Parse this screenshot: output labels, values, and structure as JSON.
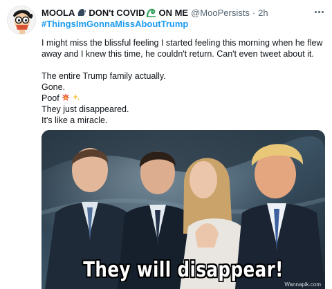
{
  "tweet": {
    "display_name_part1": "MOOLA",
    "display_name_part2": "DON't COVID",
    "display_name_part3": "ON ME",
    "handle": "@MooPersists",
    "separator": "·",
    "time": "2h",
    "hashtag": "#ThingsImGonnaMissAboutTrump",
    "body": {
      "line1": "I might miss the blissful feeling I started feeling this morning when he flew away and I knew this time, he couldn't return. Can't even tweet about it.",
      "line2": "The entire Trump family actually.",
      "line3": "Gone.",
      "line4": "Poof",
      "line5": "They just disappeared.",
      "line6": "It's like a miracle."
    },
    "media": {
      "caption": "They will disappear!",
      "watermark": "Wannapik.com"
    },
    "icons": [
      "avatar-cartoon",
      "speaking-head-emoji",
      "wave-emoji",
      "collision-emoji",
      "sparkles-emoji",
      "more-icon"
    ],
    "colors": {
      "link": "#1d9bf0",
      "text": "#0f1419",
      "muted": "#536471"
    }
  }
}
